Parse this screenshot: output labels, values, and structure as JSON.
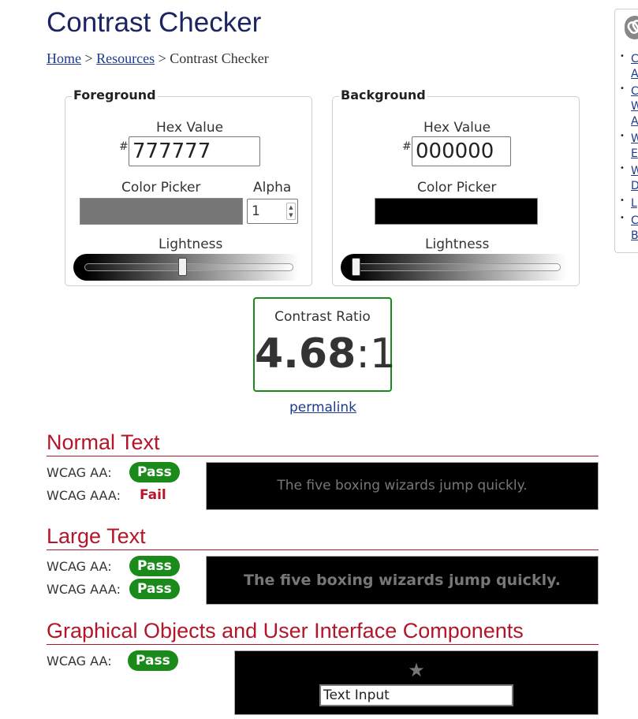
{
  "page": {
    "title": "Contrast Checker",
    "breadcrumb": {
      "home": "Home",
      "sep1": ">",
      "resources": "Resources",
      "sep2": ">",
      "current": "Contrast Checker"
    }
  },
  "foreground": {
    "legend": "Foreground",
    "hex_label": "Hex Value",
    "hash": "#",
    "hex_value": "777777",
    "picker_label": "Color Picker",
    "picker_color": "#777777",
    "alpha_label": "Alpha",
    "alpha_value": "1",
    "lightness_label": "Lightness",
    "lightness_fraction": 0.47
  },
  "background": {
    "legend": "Background",
    "hex_label": "Hex Value",
    "hash": "#",
    "hex_value": "000000",
    "picker_label": "Color Picker",
    "picker_color": "#000000",
    "lightness_label": "Lightness",
    "lightness_fraction": 0.0
  },
  "result": {
    "label": "Contrast Ratio",
    "ratio_main": "4.68",
    "ratio_suffix": ":1",
    "permalink": "permalink"
  },
  "normal_text": {
    "title": "Normal Text",
    "aa_label": "WCAG AA:",
    "aa_result": "Pass",
    "aaa_label": "WCAG AAA:",
    "aaa_result": "Fail",
    "sample": "The five boxing wizards jump quickly."
  },
  "large_text": {
    "title": "Large Text",
    "aa_label": "WCAG AA:",
    "aa_result": "Pass",
    "aaa_label": "WCAG AAA:",
    "aaa_result": "Pass",
    "sample": "The five boxing wizards jump quickly."
  },
  "graphics": {
    "title": "Graphical Objects and User Interface Components",
    "aa_label": "WCAG AA:",
    "aa_result": "Pass",
    "star": "★",
    "input_value": "Text Input"
  },
  "sidebar": {
    "icon": "link-icon",
    "items": [
      {
        "lines": [
          "C",
          "A"
        ]
      },
      {
        "lines": [
          "C",
          "W",
          "A"
        ]
      },
      {
        "lines": [
          "W",
          "E"
        ]
      },
      {
        "lines": [
          "W",
          "D"
        ]
      },
      {
        "lines": [
          "L"
        ]
      },
      {
        "lines": [
          "C",
          "B"
        ]
      }
    ]
  },
  "colors": {
    "foreground": "#777777",
    "background": "#000000",
    "pass": "#1a8a1a",
    "fail": "#b3162a",
    "heading": "#b3162a",
    "title": "#1c2562"
  }
}
